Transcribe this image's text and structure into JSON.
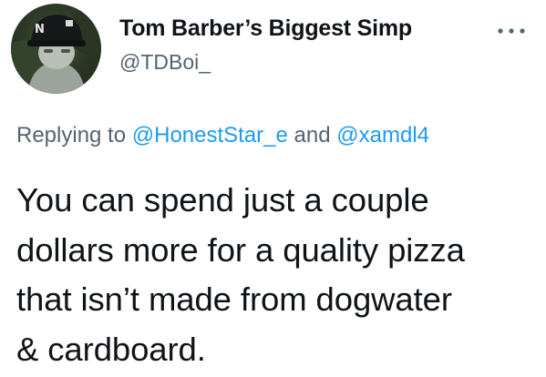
{
  "author": {
    "display_name": "Tom Barber’s Biggest Simp",
    "handle": "@TDBoi_",
    "avatar_icon": "profile-avatar"
  },
  "more_icon": "more-dots-icon",
  "reply": {
    "prefix": "Replying to ",
    "mention_1": "@HonestStar_e",
    "joiner": " and ",
    "mention_2": "@xamdl4"
  },
  "tweet": {
    "lines": [
      "You can spend just a couple",
      "dollars more for a quality pizza",
      "that isn’t made from dogwater",
      "& cardboard."
    ]
  },
  "colors": {
    "text": "#0f1419",
    "secondary": "#536471",
    "link": "#1d9bf0"
  }
}
